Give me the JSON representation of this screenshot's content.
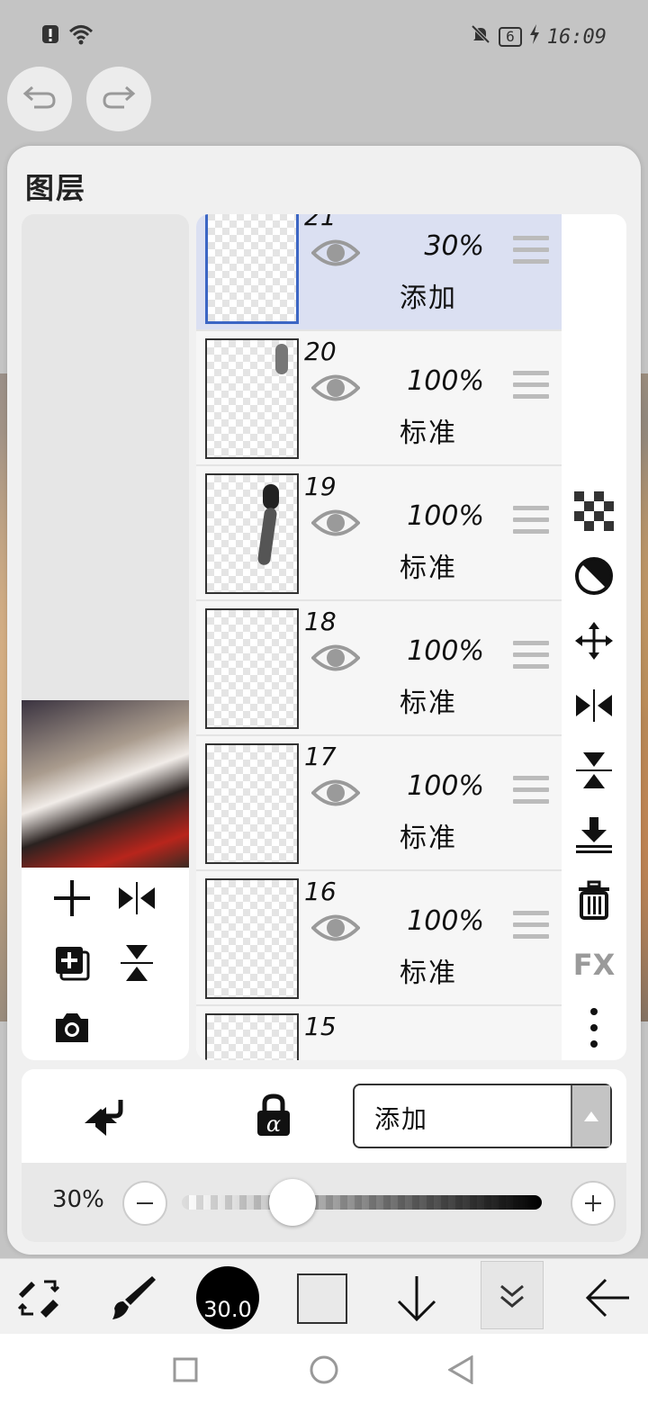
{
  "status_bar": {
    "time": "16:09",
    "battery": "6"
  },
  "panel": {
    "title": "图层",
    "layers": [
      {
        "number": "21",
        "opacity": "30%",
        "blend": "添加",
        "selected": true
      },
      {
        "number": "20",
        "opacity": "100%",
        "blend": "标准",
        "selected": false
      },
      {
        "number": "19",
        "opacity": "100%",
        "blend": "标准",
        "selected": false
      },
      {
        "number": "18",
        "opacity": "100%",
        "blend": "标准",
        "selected": false
      },
      {
        "number": "17",
        "opacity": "100%",
        "blend": "标准",
        "selected": false
      },
      {
        "number": "16",
        "opacity": "100%",
        "blend": "标准",
        "selected": false
      },
      {
        "number": "15",
        "opacity": "",
        "blend": "",
        "selected": false
      }
    ],
    "fx_label": "FX"
  },
  "bottom": {
    "blend_mode": "添加",
    "opacity_label": "30%",
    "opacity_value": 0.3
  },
  "toolbar": {
    "brush_size": "30.0"
  },
  "colors": {
    "accent": "#3c66c4",
    "selected_row": "#dbe0f2",
    "swatch": "#e9e9e9"
  }
}
